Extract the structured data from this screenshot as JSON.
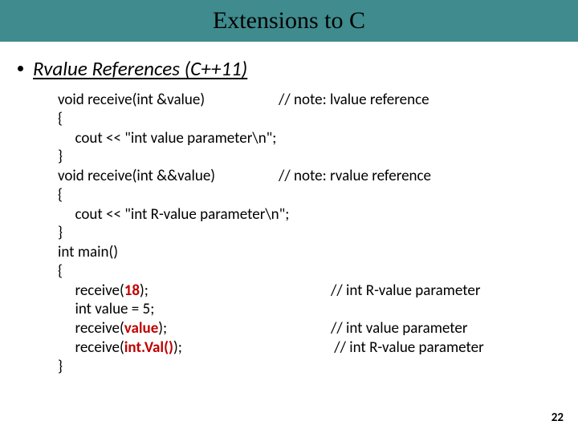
{
  "title": "Extensions to C",
  "bullet": "Rvalue References (C++11)",
  "code": {
    "l1a": "void receive(int &value)",
    "l1b": "// note: lvalue reference",
    "l2": "{",
    "l3": "     cout << \"int value parameter\\n\";",
    "l4": "}",
    "l5a": "void receive(int &&value)",
    "l5b": "// note: rvalue reference",
    "l6": "{",
    "l7": "     cout << \"int R-value parameter\\n\";",
    "l8": "}",
    "l9": "int main()",
    "l10": "{",
    "l11a": "     receive(",
    "l11b": "18",
    "l11c": ");",
    "l11d": "// int R-value parameter",
    "l12": "     int value = 5;",
    "l13a": "     receive(",
    "l13b": "value",
    "l13c": ");",
    "l13d": "// int value parameter",
    "l14a": "     receive(",
    "l14b": "int.Val()",
    "l14c": ");",
    "l14d": " // int R-value parameter",
    "l15": "}"
  },
  "page_number": "22"
}
